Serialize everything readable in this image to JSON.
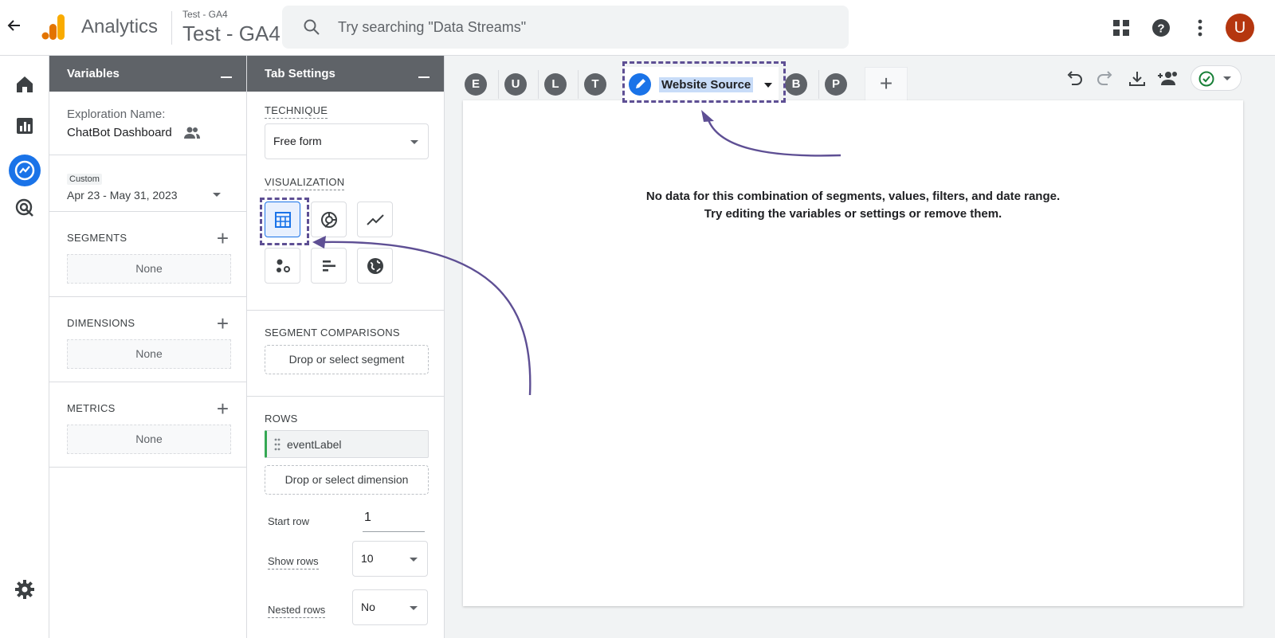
{
  "header": {
    "brand": "Analytics",
    "property_small": "Test - GA4",
    "property_name": "Test - GA4",
    "search_placeholder": "Try searching \"Data Streams\"",
    "avatar_initial": "U",
    "icons": [
      "back-arrow-icon",
      "apps-grid-icon",
      "help-icon",
      "more-vert-icon"
    ]
  },
  "leftnav": {
    "icons": [
      "home-icon",
      "reports-icon",
      "explore-icon",
      "advertising-icon",
      "settings-icon"
    ],
    "active": "explore-icon",
    "accent": "#1a73e8"
  },
  "variables": {
    "title": "Variables",
    "exploration_label": "Exploration Name:",
    "exploration_name": "ChatBot Dashboard",
    "date_badge": "Custom",
    "date_range": "Apr 23 - May 31, 2023",
    "segments": {
      "title": "SEGMENTS",
      "value": "None"
    },
    "dimensions": {
      "title": "DIMENSIONS",
      "value": "None"
    },
    "metrics": {
      "title": "METRICS",
      "value": "None"
    }
  },
  "tab_settings": {
    "title": "Tab Settings",
    "technique_label": "TECHNIQUE",
    "technique_value": "Free form",
    "visualization_label": "VISUALIZATION",
    "viz_icons": [
      "table-icon",
      "donut-chart-icon",
      "line-chart-icon",
      "scatter-plot-icon",
      "bar-chart-icon",
      "geo-map-icon"
    ],
    "active_viz": "table-icon",
    "segment_comparisons_label": "SEGMENT COMPARISONS",
    "segment_drop": "Drop or select segment",
    "rows_label": "ROWS",
    "row_item": "eventLabel",
    "row_drop": "Drop or select dimension",
    "start_row_label": "Start row",
    "start_row_value": "1",
    "show_rows_label": "Show rows",
    "show_rows_value": "10",
    "nested_rows_label": "Nested rows",
    "nested_rows_value": "No"
  },
  "canvas": {
    "tabs": [
      "E",
      "U",
      "L",
      "T"
    ],
    "active_tab": "Website Source",
    "tabs_after": [
      "B",
      "P"
    ],
    "add_tab": "+",
    "message_line1": "No data for this combination of segments, values, filters, and date range.",
    "message_line2": "Try editing the variables or settings or remove them.",
    "toolbar_icons": [
      "undo-icon",
      "redo-icon",
      "download-icon",
      "share-icon",
      "status-check-icon"
    ]
  },
  "annotation_color": "#5e4f94"
}
